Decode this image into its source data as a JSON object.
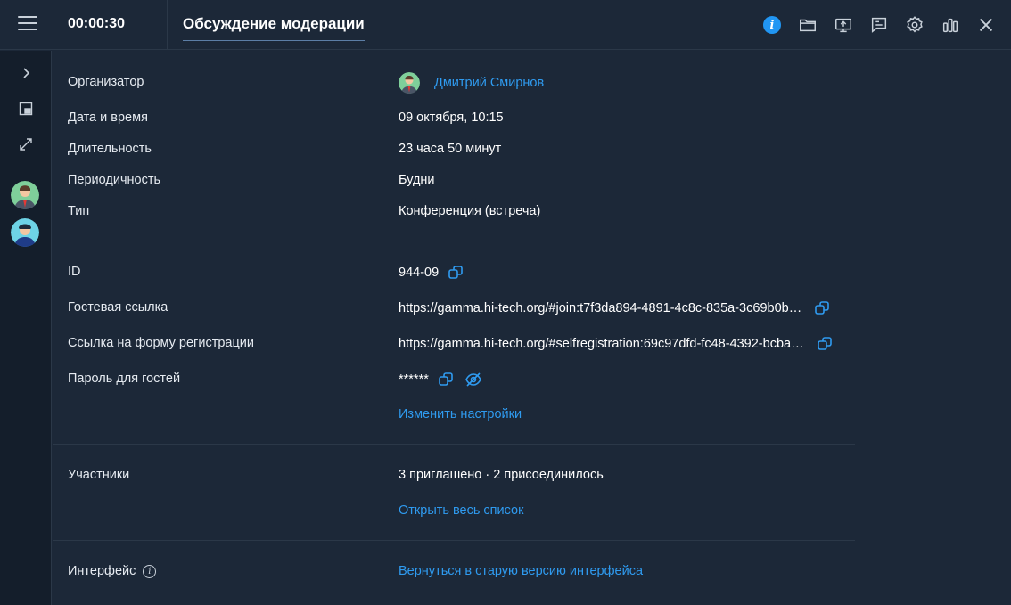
{
  "header": {
    "timer": "00:00:30",
    "title": "Обсуждение модерации",
    "icons": [
      "info-icon",
      "folder-icon",
      "screen-share-icon",
      "chat-icon",
      "settings-icon",
      "stats-icon",
      "close-icon"
    ],
    "accent_color": "#2196f3"
  },
  "sidebar": {
    "icons": [
      "expand-chevron-icon",
      "picture-in-picture-icon",
      "fullscreen-icon"
    ],
    "participants": [
      "avatar-1",
      "avatar-2"
    ]
  },
  "details": {
    "organizer_label": "Организатор",
    "organizer_name": "Дмитрий Смирнов",
    "datetime_label": "Дата и время",
    "datetime_value": "09 октября, 10:15",
    "duration_label": "Длительность",
    "duration_value": "23 часа 50 минут",
    "recurrence_label": "Периодичность",
    "recurrence_value": "Будни",
    "type_label": "Тип",
    "type_value": "Конференция (встреча)"
  },
  "access": {
    "id_label": "ID",
    "id_value": "944-09",
    "guest_link_label": "Гостевая ссылка",
    "guest_link_value": "https://gamma.hi-tech.org/#join:t7f3da894-4891-4c8c-835a-3c69b0b…",
    "reg_link_label": "Ссылка на форму регистрации",
    "reg_link_value": "https://gamma.hi-tech.org/#selfregistration:69c97dfd-fc48-4392-bcba…",
    "password_label": "Пароль для гостей",
    "password_value": "******",
    "change_settings": "Изменить настройки"
  },
  "participants": {
    "label": "Участники",
    "summary": "3 приглашено · 2 присоединилось",
    "open_list": "Открыть весь список"
  },
  "interface": {
    "label": "Интерфейс",
    "return_old": "Вернуться в старую версию интерфейса"
  }
}
